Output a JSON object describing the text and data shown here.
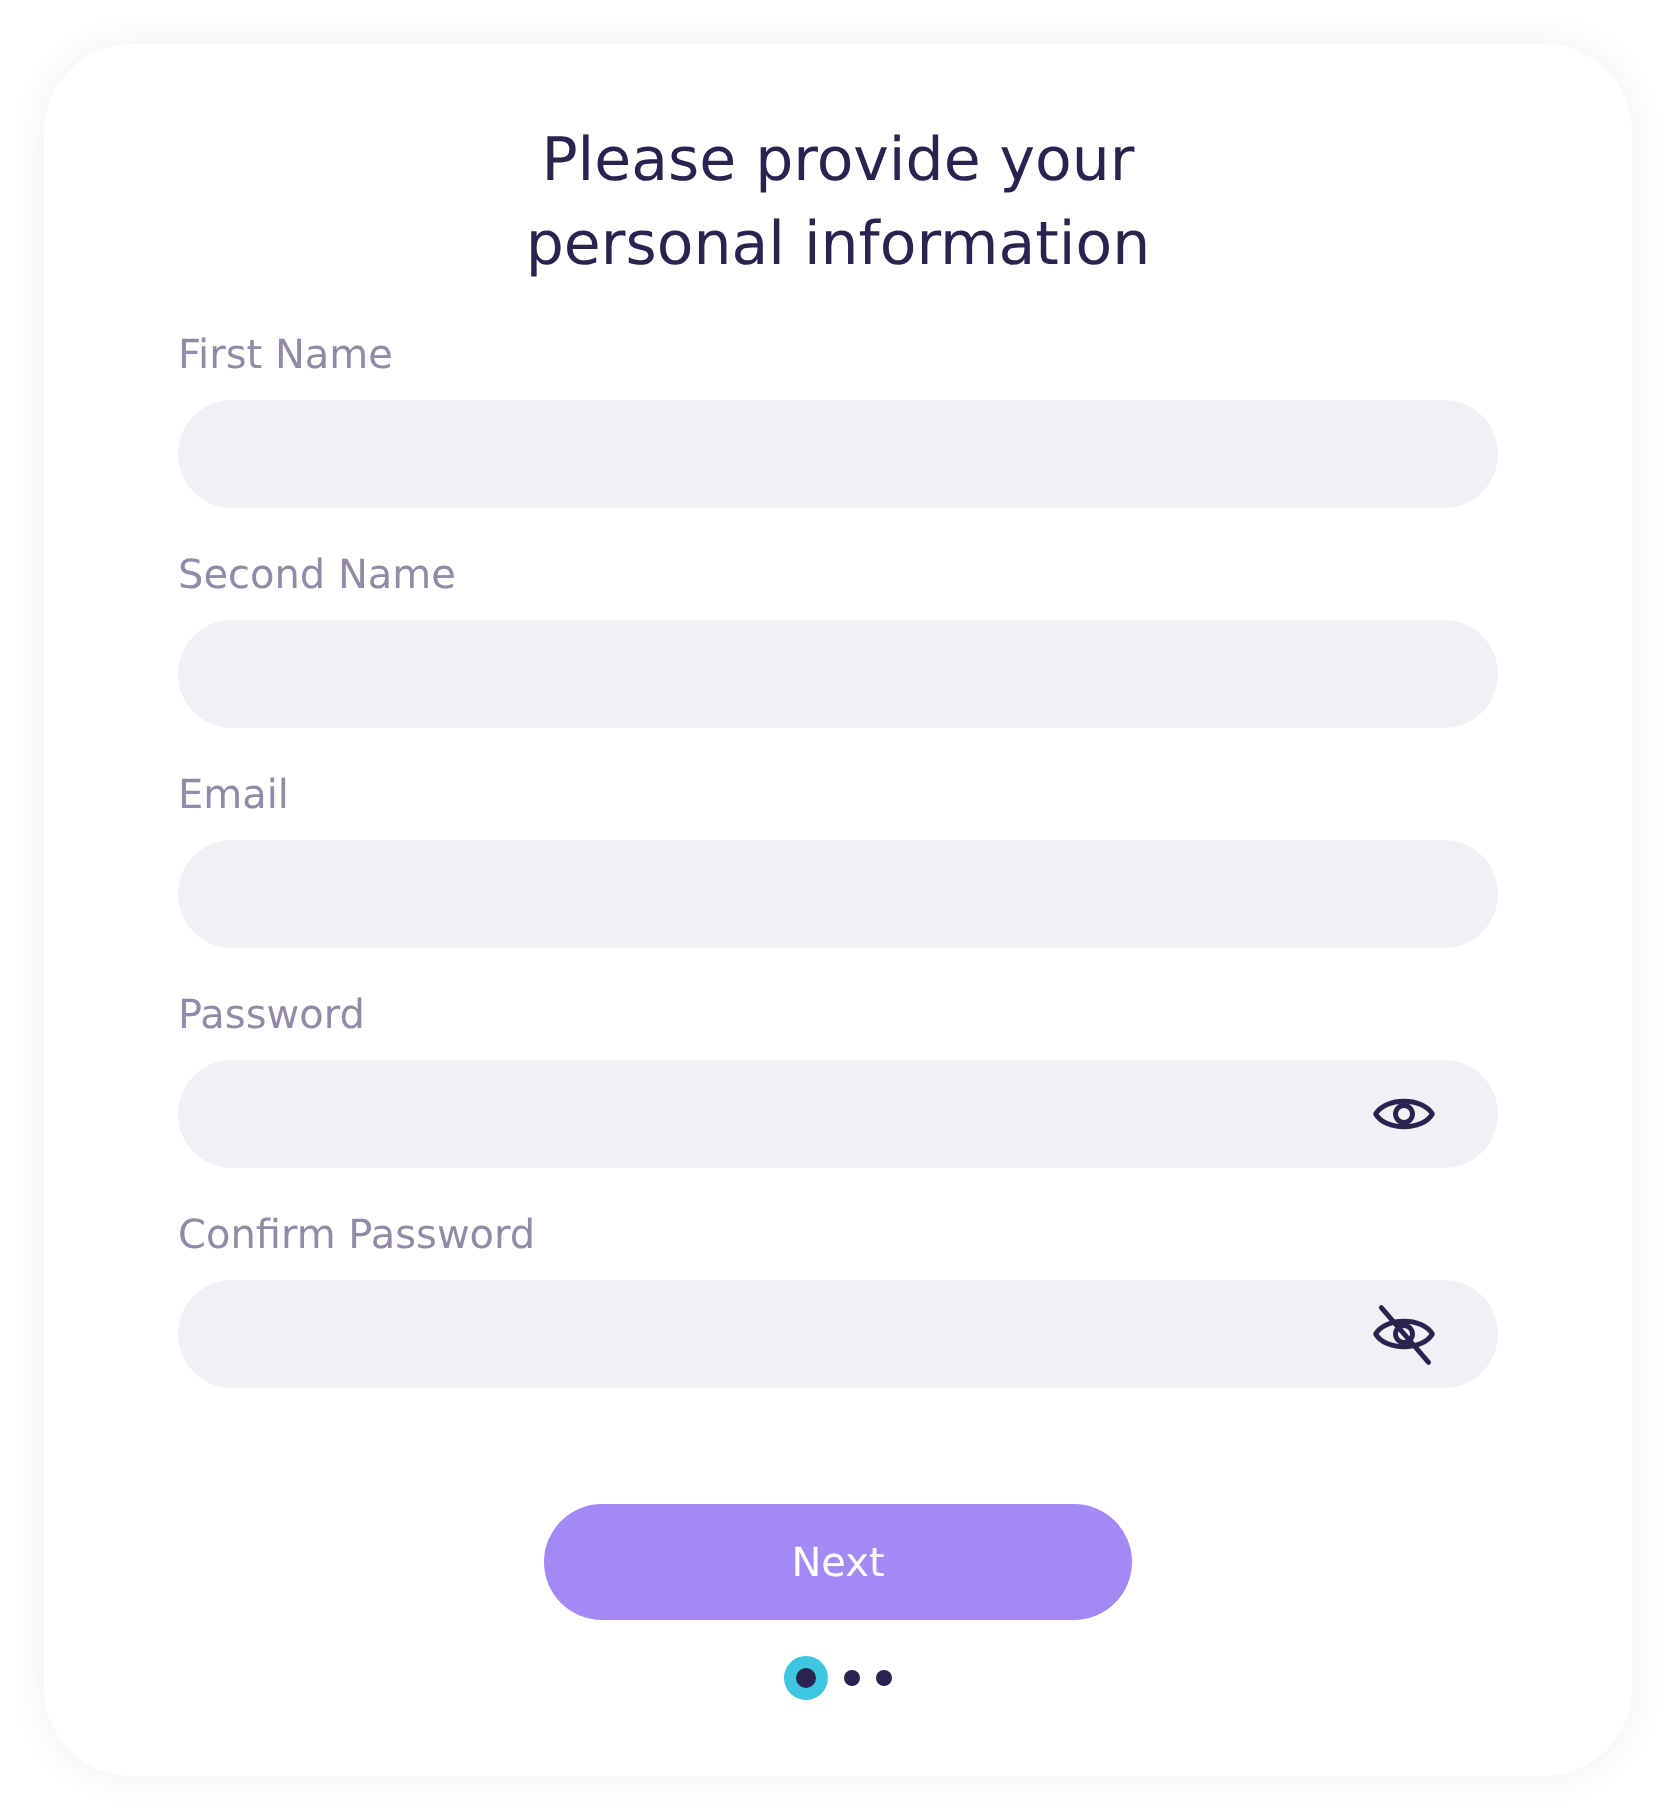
{
  "title": "Please provide your\npersonal information",
  "fields": [
    {
      "label": "First Name",
      "kind": "text"
    },
    {
      "label": "Second Name",
      "kind": "text"
    },
    {
      "label": "Email",
      "kind": "text"
    },
    {
      "label": "Password",
      "kind": "password",
      "visible": true
    },
    {
      "label": "Confirm Password",
      "kind": "password",
      "visible": false
    }
  ],
  "button": "Next",
  "steps": [
    {
      "selected": true
    },
    {
      "selected": false
    },
    {
      "selected": false
    }
  ]
}
